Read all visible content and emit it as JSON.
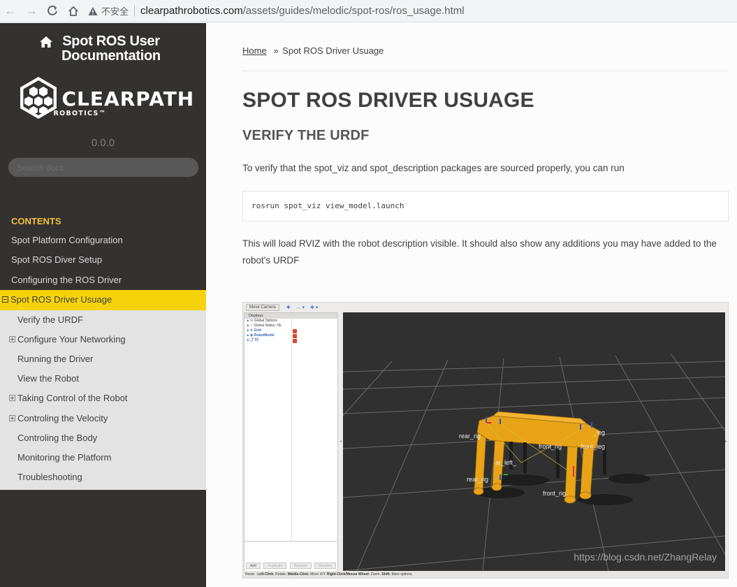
{
  "browser": {
    "security_label": "不安全",
    "url_host": "clearpathrobotics.com",
    "url_path": "/assets/guides/melodic/spot-ros/ros_usage.html"
  },
  "sidebar": {
    "project_title": "Spot ROS User Documentation",
    "logo_text": "CLEARPATH",
    "logo_subtext": "ROBOTICS™",
    "version": "0.0.0",
    "search_placeholder": "Search docs",
    "toc_caption": "CONTENTS",
    "toc_items": [
      "Spot Platform Configuration",
      "Spot ROS Diver Setup",
      "Configuring the ROS Driver",
      "Spot ROS Driver Usuage"
    ],
    "sub_items": [
      "Verify the URDF",
      "Configure Your Networking",
      "Running the Driver",
      "View the Robot",
      "Taking Control of the Robot",
      "Controling the Velocity",
      "Controling the Body",
      "Monitoring the Platform",
      "Troubleshooting"
    ]
  },
  "content": {
    "breadcrumb_home": "Home",
    "breadcrumb_sep": "»",
    "breadcrumb_current": "Spot ROS Driver Usuage",
    "page_title": "SPOT ROS DRIVER USUAGE",
    "section_title": "VERIFY THE URDF",
    "para1": "To verify that the spot_viz and spot_description packages are sourced properly, you can run",
    "code": "rosrun spot_viz view_model.launch",
    "para2": "This will load RVIZ with the robot description visible. It should also show any additions you may have added to the robot's URDF"
  },
  "rviz": {
    "toolbar_move_camera": "Move Camera",
    "displays_header": "Displays",
    "display_items": [
      "Global Options",
      "Global Status: Ok",
      "Grid",
      "RobotModel",
      "TF"
    ],
    "buttons": [
      "Add",
      "Duplicate",
      "Remove",
      "Rename"
    ],
    "status_reset": "Reset",
    "status_left": "Left-Click:",
    "status_left_action": "Rotate.",
    "status_middle": "Middle-Click:",
    "status_middle_action": "Move X/Y.",
    "status_right": "Right-Click/Mouse Wheel:",
    "status_right_action": "Zoom.",
    "status_shift": "Shift:",
    "status_shift_action": "More options.",
    "labels": {
      "rear_rig_top": "rear_rig",
      "front_rig_top": "front_rig",
      "leg_right": "_leg",
      "front_leg": "front_leg",
      "ar_left": "ar_left_",
      "rear_rig_bottom": "rear_rig",
      "front_rig_bottom": "front_rig"
    },
    "watermark": "https://blog.csdn.net/ZhangRelay",
    "robot_color": "#e8a317"
  }
}
